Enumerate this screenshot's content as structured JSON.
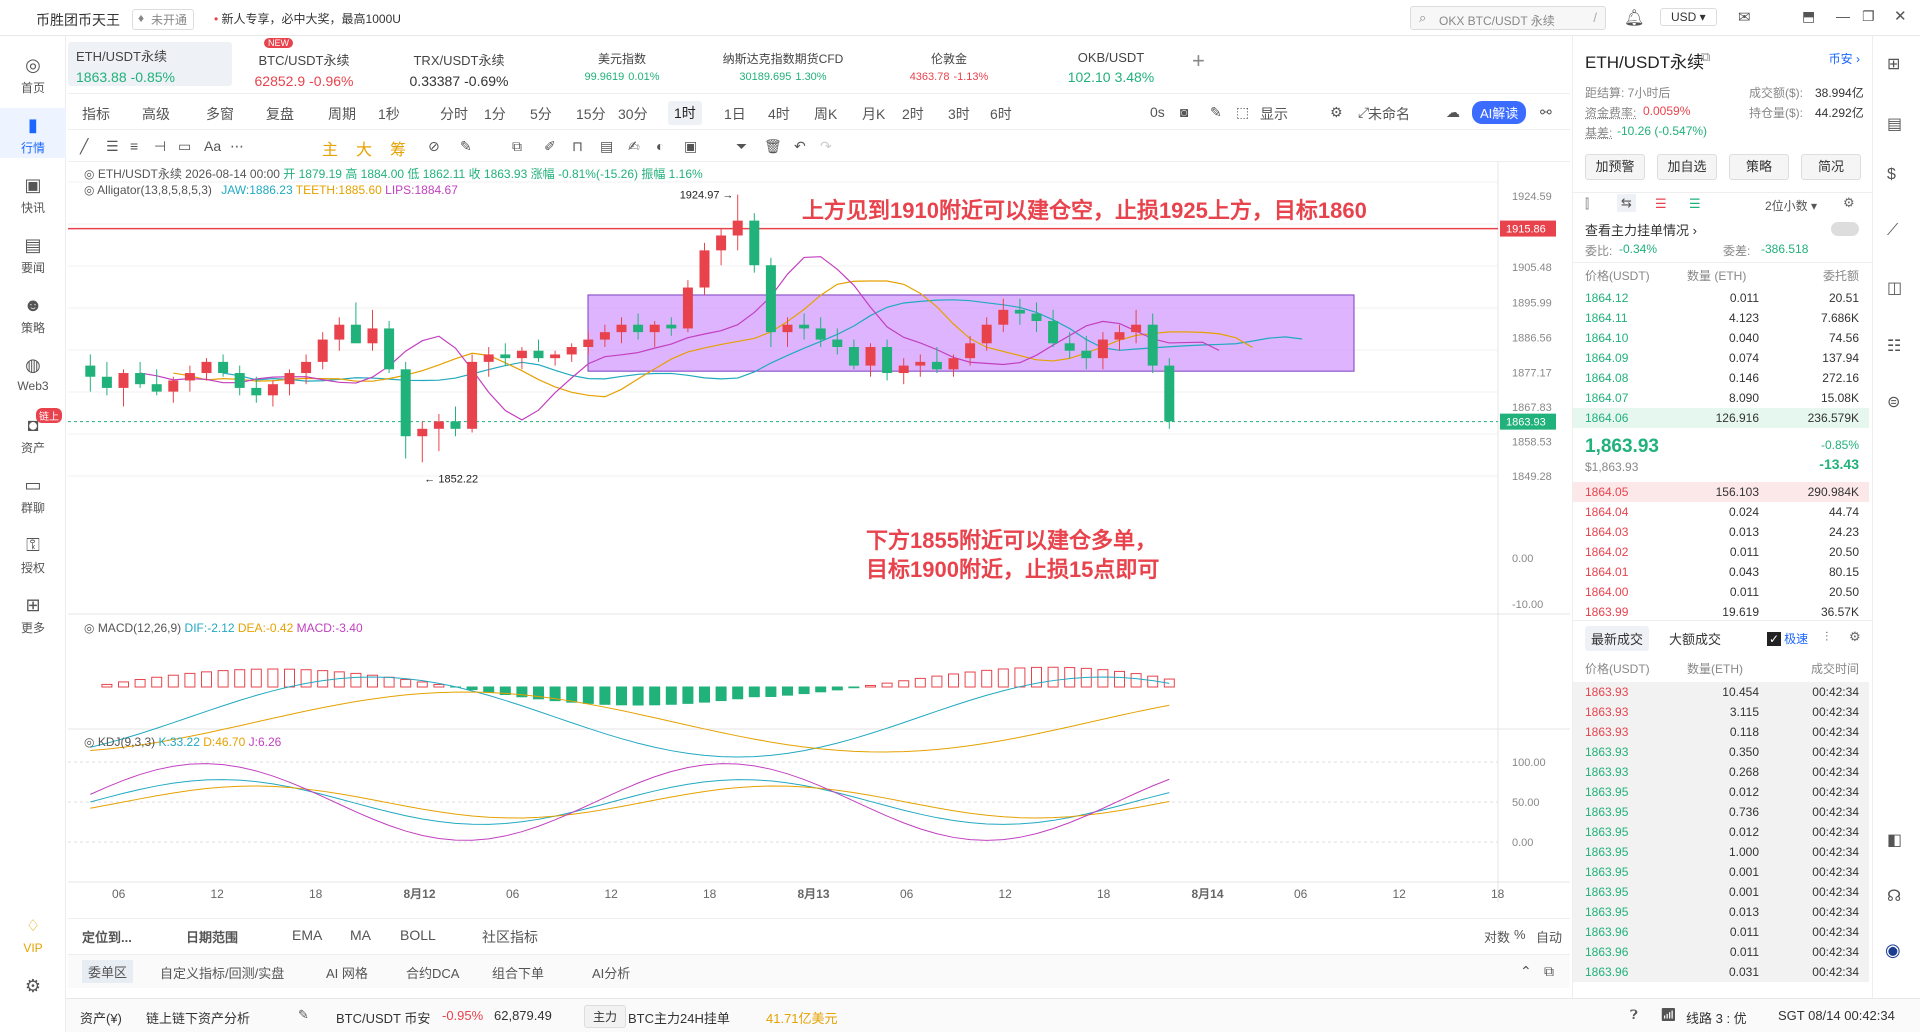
{
  "topbar": {
    "app_name": "币胜团币天王",
    "badge": "未开通",
    "promo": "新人专享，必中大奖，最高1000U",
    "search_placeholder": "OKX BTC/USDT 永续",
    "currency": "USD"
  },
  "sidebar": {
    "items": [
      {
        "label": "首页",
        "icon": "home-icon"
      },
      {
        "label": "行情",
        "icon": "chart-bar-icon"
      },
      {
        "label": "快讯",
        "icon": "news-icon"
      },
      {
        "label": "要闻",
        "icon": "document-icon"
      },
      {
        "label": "策略",
        "icon": "robot-icon"
      },
      {
        "label": "Web3",
        "icon": "web3-icon"
      },
      {
        "label": "资产",
        "icon": "wallet-icon",
        "badge": "链上"
      },
      {
        "label": "群聊",
        "icon": "chat-icon"
      },
      {
        "label": "授权",
        "icon": "key-icon"
      },
      {
        "label": "更多",
        "icon": "grid-icon"
      }
    ],
    "vip": "VIP"
  },
  "tickers": [
    {
      "name": "ETH/USDT永续",
      "price": "1863.88",
      "change": "-0.85%"
    },
    {
      "name": "BTC/USDT永续",
      "price": "62852.9",
      "change": "-0.96%",
      "new_badge": "NEW"
    },
    {
      "name": "TRX/USDT永续",
      "price": "0.33387",
      "change": "-0.69%"
    },
    {
      "name": "美元指数",
      "price": "99.9619",
      "change": "0.01%"
    },
    {
      "name": "纳斯达克指数期货CFD",
      "price": "30189.695",
      "change": "1.30%"
    },
    {
      "name": "伦敦金",
      "price": "4363.78",
      "change": "-1.13%"
    },
    {
      "name": "OKB/USDT",
      "price": "102.10",
      "change": "3.48%"
    }
  ],
  "toolbar1": [
    "指标",
    "高级",
    "多窗",
    "复盘",
    "周期",
    "1秒",
    "分时",
    "1分",
    "5分",
    "15分",
    "30分",
    "1时",
    "1日",
    "4时",
    "周K",
    "月K",
    "2时",
    "3时",
    "6时",
    "0s",
    "显示",
    "未命名",
    "AI解读"
  ],
  "toolbar2_text": [
    "主",
    "大",
    "筹"
  ],
  "ohlc": {
    "pair": "ETH/USDT永续",
    "date": "2026-08-14 00:00",
    "open": "开 1879.19",
    "high": "高 1884.00",
    "low": "低 1862.11",
    "close": "收 1863.93",
    "chg": "涨幅 -0.81%(-15.26)",
    "amp": "振幅 1.16%"
  },
  "alligator": {
    "label": "Alligator(13,8,5,8,5,3)",
    "jaw": "JAW:1886.23",
    "teeth": "TEETH:1885.60",
    "lips": "LIPS:1884.67"
  },
  "macd": {
    "label": "MACD(12,26,9)",
    "dif": "DIF:-2.12",
    "dea": "DEA:-0.42",
    "macd": "MACD:-3.40",
    "ticks": [
      "0.00",
      "-10.00"
    ]
  },
  "kdj": {
    "label": "KDJ(9,3,3)",
    "k": "K:33.22",
    "d": "D:46.70",
    "j": "J:6.26",
    "ticks": [
      "100.00",
      "50.00",
      "0.00"
    ]
  },
  "price_axis": [
    "1924.59",
    "1905.48",
    "1895.99",
    "1886.56",
    "1877.17",
    "1867.83",
    "1858.53",
    "1849.28"
  ],
  "price_tags": {
    "resistance": "1915.86",
    "last": "1863.93"
  },
  "annotations": {
    "high": "1924.97",
    "low": "1852.22",
    "short": "上方见到1910附近可以建仓空，止损1925上方，目标1860",
    "long1": "下方1855附近可以建仓多单，",
    "long2": "目标1900附近，止损15点即可"
  },
  "chart_data": {
    "type": "candlestick",
    "interval": "1时",
    "series_name": "ETH/USDT永续",
    "y_range": [
      1845,
      1930
    ],
    "x_labels": [
      "06",
      "12",
      "18",
      "8月12",
      "06",
      "12",
      "18",
      "8月13",
      "06",
      "12",
      "18",
      "8月14",
      "06",
      "12",
      "18"
    ],
    "candles": [
      [
        1879,
        1882,
        1872,
        1876
      ],
      [
        1876,
        1880,
        1871,
        1873
      ],
      [
        1873,
        1878,
        1868,
        1877
      ],
      [
        1877,
        1880,
        1873,
        1874
      ],
      [
        1874,
        1878,
        1871,
        1872
      ],
      [
        1872,
        1876,
        1869,
        1875
      ],
      [
        1875,
        1879,
        1872,
        1877
      ],
      [
        1877,
        1881,
        1875,
        1880
      ],
      [
        1880,
        1882,
        1876,
        1877
      ],
      [
        1877,
        1879,
        1871,
        1873
      ],
      [
        1873,
        1876,
        1869,
        1871
      ],
      [
        1871,
        1875,
        1868,
        1874
      ],
      [
        1874,
        1878,
        1871,
        1877
      ],
      [
        1877,
        1882,
        1874,
        1880
      ],
      [
        1880,
        1888,
        1878,
        1886
      ],
      [
        1886,
        1892,
        1883,
        1890
      ],
      [
        1890,
        1896,
        1887,
        1885
      ],
      [
        1885,
        1894,
        1883,
        1889
      ],
      [
        1889,
        1891,
        1877,
        1878
      ],
      [
        1878,
        1880,
        1854,
        1860
      ],
      [
        1860,
        1864,
        1853,
        1862
      ],
      [
        1862,
        1866,
        1856,
        1864
      ],
      [
        1864,
        1868,
        1860,
        1862
      ],
      [
        1862,
        1882,
        1861,
        1880
      ],
      [
        1880,
        1884,
        1876,
        1882
      ],
      [
        1882,
        1885,
        1879,
        1881
      ],
      [
        1881,
        1884,
        1878,
        1883
      ],
      [
        1883,
        1886,
        1880,
        1881
      ],
      [
        1881,
        1883,
        1879,
        1882
      ],
      [
        1882,
        1885,
        1880,
        1884
      ],
      [
        1884,
        1888,
        1882,
        1886
      ],
      [
        1886,
        1890,
        1884,
        1888
      ],
      [
        1888,
        1892,
        1885,
        1890
      ],
      [
        1890,
        1893,
        1886,
        1888
      ],
      [
        1888,
        1891,
        1884,
        1890
      ],
      [
        1890,
        1892,
        1887,
        1889
      ],
      [
        1889,
        1902,
        1888,
        1900
      ],
      [
        1900,
        1912,
        1898,
        1910
      ],
      [
        1910,
        1916,
        1906,
        1914
      ],
      [
        1914,
        1925,
        1910,
        1918
      ],
      [
        1918,
        1920,
        1904,
        1906
      ],
      [
        1906,
        1908,
        1884,
        1888
      ],
      [
        1888,
        1892,
        1884,
        1890
      ],
      [
        1890,
        1893,
        1886,
        1889
      ],
      [
        1889,
        1892,
        1884,
        1886
      ],
      [
        1886,
        1889,
        1882,
        1884
      ],
      [
        1884,
        1886,
        1878,
        1879
      ],
      [
        1879,
        1885,
        1876,
        1884
      ],
      [
        1884,
        1886,
        1875,
        1877
      ],
      [
        1877,
        1881,
        1874,
        1879
      ],
      [
        1879,
        1882,
        1876,
        1880
      ],
      [
        1880,
        1884,
        1877,
        1878
      ],
      [
        1878,
        1882,
        1876,
        1881
      ],
      [
        1881,
        1887,
        1879,
        1885
      ],
      [
        1885,
        1892,
        1883,
        1890
      ],
      [
        1890,
        1897,
        1888,
        1894
      ],
      [
        1894,
        1897,
        1890,
        1893
      ],
      [
        1893,
        1896,
        1888,
        1891
      ],
      [
        1891,
        1894,
        1884,
        1885
      ],
      [
        1885,
        1888,
        1881,
        1883
      ],
      [
        1883,
        1887,
        1878,
        1881
      ],
      [
        1881,
        1888,
        1878,
        1886
      ],
      [
        1886,
        1890,
        1883,
        1888
      ],
      [
        1888,
        1894,
        1885,
        1890
      ],
      [
        1890,
        1893,
        1877,
        1879
      ],
      [
        1879,
        1881,
        1862,
        1864
      ]
    ]
  },
  "bottom_tabs": [
    "定位到...",
    "日期范围",
    "EMA",
    "MA",
    "BOLL",
    "社区指标",
    "对数",
    "%",
    "自动"
  ],
  "bottom_tabs2": [
    "委单区",
    "自定义指标/回测/实盘",
    "AI 网格",
    "合约DCA",
    "组合下单",
    "AI分析"
  ],
  "status": {
    "asset": "资产(¥)",
    "analysis": "链上链下资产分析",
    "pair": "BTC/USDT 币安",
    "chg": "-0.95%",
    "price": "62,879.49",
    "main_badge": "主力",
    "main_text": "BTC主力24H挂单",
    "main_val": "41.71亿美元",
    "line": "线路 3 : 优",
    "time": "SGT 08/14 00:42:34"
  },
  "right": {
    "title": "ETH/USDT永续",
    "exchange": "币安",
    "settle": "距结算: 7小时后",
    "vol_label": "成交额($):",
    "vol": "38.994亿",
    "funding_label": "资金费率:",
    "funding": "0.0059%",
    "oi_label": "持仓量($):",
    "oi": "44.292亿",
    "basis_label": "基差:",
    "basis": "-10.26 (-0.547%)",
    "buttons": [
      "加预警",
      "加自选",
      "策略",
      "简况"
    ],
    "decimals": "2位小数",
    "big_orders": "查看主力挂单情况",
    "ratio_label": "委比:",
    "ratio": "-0.34%",
    "diff_label": "委差:",
    "diff": "-386.518",
    "ob_headers": [
      "价格(USDT)",
      "数量 (ETH)",
      "委托额"
    ],
    "asks": [
      [
        "1864.12",
        "0.011",
        "20.51"
      ],
      [
        "1864.11",
        "4.123",
        "7.686K"
      ],
      [
        "1864.10",
        "0.040",
        "74.56"
      ],
      [
        "1864.09",
        "0.074",
        "137.94"
      ],
      [
        "1864.08",
        "0.146",
        "272.16"
      ],
      [
        "1864.07",
        "8.090",
        "15.08K"
      ],
      [
        "1864.06",
        "126.916",
        "236.579K"
      ]
    ],
    "mid_price": "1,863.93",
    "mid_usd": "$1,863.93",
    "mid_pct": "-0.85%",
    "mid_chg": "-13.43",
    "bids": [
      [
        "1864.05",
        "156.103",
        "290.984K"
      ],
      [
        "1864.04",
        "0.024",
        "44.74"
      ],
      [
        "1864.03",
        "0.013",
        "24.23"
      ],
      [
        "1864.02",
        "0.011",
        "20.50"
      ],
      [
        "1864.01",
        "0.043",
        "80.15"
      ],
      [
        "1864.00",
        "0.011",
        "20.50"
      ],
      [
        "1863.99",
        "19.619",
        "36.57K"
      ]
    ],
    "trade_tabs": [
      "最新成交",
      "大额成交",
      "极速"
    ],
    "tr_headers": [
      "价格(USDT)",
      "数量(ETH)",
      "成交时间"
    ],
    "trades": [
      [
        "1863.93",
        "10.454",
        "00:42:34",
        "s"
      ],
      [
        "1863.93",
        "3.115",
        "00:42:34",
        "s"
      ],
      [
        "1863.93",
        "0.118",
        "00:42:34",
        "s"
      ],
      [
        "1863.93",
        "0.350",
        "00:42:34",
        "b"
      ],
      [
        "1863.93",
        "0.268",
        "00:42:34",
        "b"
      ],
      [
        "1863.95",
        "0.012",
        "00:42:34",
        "b"
      ],
      [
        "1863.95",
        "0.736",
        "00:42:34",
        "b"
      ],
      [
        "1863.95",
        "0.012",
        "00:42:34",
        "b"
      ],
      [
        "1863.95",
        "1.000",
        "00:42:34",
        "b"
      ],
      [
        "1863.95",
        "0.001",
        "00:42:34",
        "b"
      ],
      [
        "1863.95",
        "0.001",
        "00:42:34",
        "b"
      ],
      [
        "1863.95",
        "0.013",
        "00:42:34",
        "b"
      ],
      [
        "1863.96",
        "0.011",
        "00:42:34",
        "b"
      ],
      [
        "1863.96",
        "0.011",
        "00:42:34",
        "b"
      ],
      [
        "1863.96",
        "0.031",
        "00:42:34",
        "b"
      ]
    ]
  }
}
